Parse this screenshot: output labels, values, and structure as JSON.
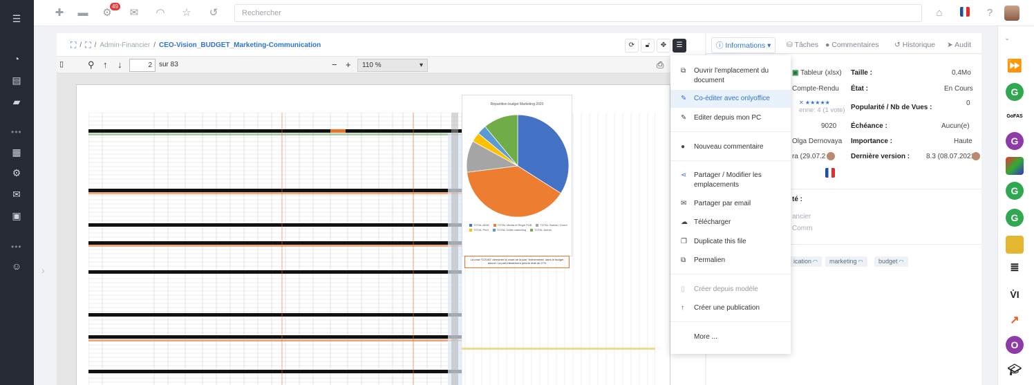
{
  "topbar": {
    "search_placeholder": "Rechercher",
    "notification_count": "49"
  },
  "breadcrumb": {
    "sep": "/",
    "item1": "Admin-Financier",
    "current": "CEO-Vision_BUDGET_Marketing-Communication"
  },
  "pdf": {
    "page": "2",
    "page_count": "sur 83",
    "zoom": "110 %",
    "chart_title": "Répartition budget Marketing 2020",
    "chart_note": "La crise \"COVID\" démontre la chute de la part \"évènements\" dans le budget annuel. La part initialement prévue était de 27%",
    "legend": [
      {
        "label": "TOTAL ADW",
        "color": "#4472c4"
      },
      {
        "label": "TOTAL Media et Régie PUB",
        "color": "#ed7d31"
      },
      {
        "label": "TOTAL Salons / Event",
        "color": "#a5a5a5"
      },
      {
        "label": "TOTAL Print",
        "color": "#ffc000"
      },
      {
        "label": "TOTAL Outils marketing",
        "color": "#5b9bd5"
      },
      {
        "label": "TOTAL Autres",
        "color": "#70ad47"
      }
    ]
  },
  "menu": {
    "items": [
      {
        "label": "Ouvrir l'emplacement du document",
        "icon": "external-link-icon"
      },
      {
        "label": "Co-éditer avec onlyoffice",
        "icon": "edit-icon"
      },
      {
        "label": "Editer depuis mon PC",
        "icon": "edit-icon"
      },
      {
        "label": "Nouveau commentaire",
        "icon": "comment-icon"
      },
      {
        "label": "Partager / Modifier les emplacements",
        "icon": "share-icon"
      },
      {
        "label": "Partager par email",
        "icon": "envelope-icon"
      },
      {
        "label": "Télécharger",
        "icon": "download-icon"
      },
      {
        "label": "Duplicate this file",
        "icon": "copy-icon"
      },
      {
        "label": "Permalien",
        "icon": "link-icon"
      },
      {
        "label": "Créer depuis modèle",
        "icon": "file-icon"
      },
      {
        "label": "Créer une publication",
        "icon": "arrow-up-icon"
      },
      {
        "label": "More ...",
        "icon": ""
      }
    ]
  },
  "panel": {
    "tabs": [
      "Informations",
      "Tâches",
      "Commentaires",
      "Historique",
      "Audit"
    ],
    "type_value": "Tableur (xlsx)",
    "compte": "Compte-Rendu",
    "rating_text": "enne: 4 (1 vote)",
    "number": "9020",
    "person": "Olga Dernovaya",
    "date_partial": "ra (29.07.2",
    "labels": {
      "taille": "Taille :",
      "etat": "État :",
      "popularite": "Popularité / Nb de Vues :",
      "echeance": "Échéance :",
      "importance": "Importance :",
      "derniere": "Dernière version :"
    },
    "values": {
      "taille": "0,4Mo",
      "etat": "En Cours",
      "popularite": "0",
      "echeance": "Aucun(e)",
      "importance": "Haute",
      "derniere": "8.3 (08.07.2021)"
    },
    "section_partial": "té :",
    "sub1": "ancier",
    "sub2": "Comm",
    "tags": [
      "ication",
      "marketing",
      "budget"
    ]
  },
  "chart_data": {
    "type": "pie",
    "title": "Répartition budget Marketing 2020",
    "categories": [
      "TOTAL ADW",
      "TOTAL Media et Régie PUB",
      "TOTAL Salons / Event",
      "TOTAL Print",
      "TOTAL Outils marketing",
      "TOTAL Autres"
    ],
    "values": [
      34,
      39,
      10,
      3,
      3,
      11
    ]
  }
}
